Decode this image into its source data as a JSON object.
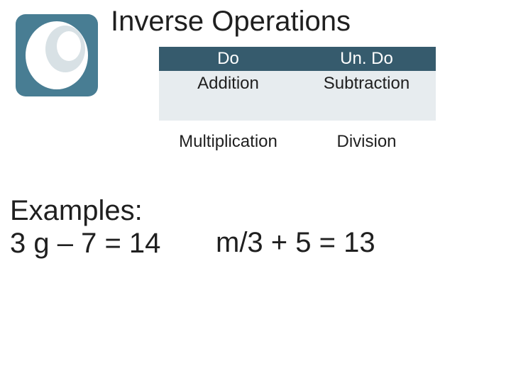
{
  "title": "Inverse Operations",
  "table": {
    "headers": {
      "left": "Do",
      "right": "Un. Do"
    },
    "rows": [
      {
        "left": "Addition",
        "right": "Subtraction"
      },
      {
        "left": "Multiplication",
        "right": "Division"
      }
    ]
  },
  "examples": {
    "label": "Examples:",
    "eq_left": "3 g – 7 = 14",
    "eq_right": "m/3 + 5 = 13"
  }
}
